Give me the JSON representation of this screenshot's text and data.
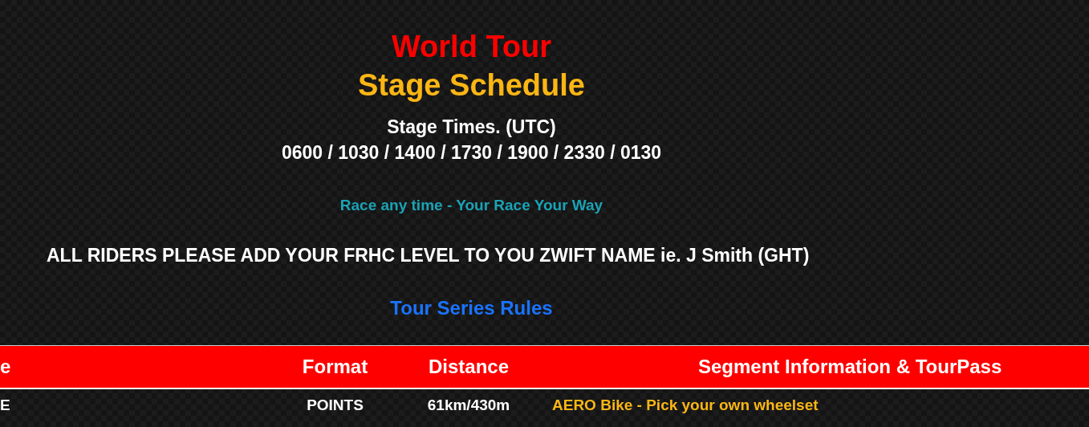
{
  "title": "World Tour",
  "subtitle": "Stage Schedule",
  "stage_times": {
    "label": "Stage Times. (UTC)",
    "times": "0600 / 1030 / 1400 / 1730 / 1900 / 2330 / 0130"
  },
  "tagline": "Race any time - Your Race Your Way",
  "notice": "ALL RIDERS PLEASE ADD YOUR FRHC LEVEL TO YOU ZWIFT NAME ie. J Smith (GHT)",
  "rules_link": "Tour Series Rules",
  "table": {
    "columns": [
      "e",
      "Format",
      "Distance",
      "Segment Information & TourPass"
    ],
    "rows": [
      [
        "E",
        "POINTS",
        "61km/430m",
        "AERO Bike - Pick your own wheelset"
      ]
    ]
  }
}
